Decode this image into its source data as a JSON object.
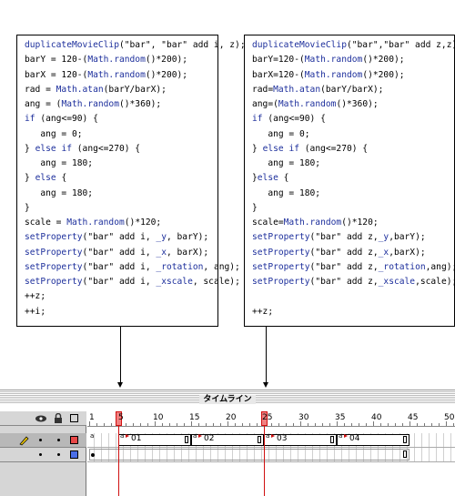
{
  "code_left": {
    "lines": [
      [
        {
          "t": "duplicateMovieClip",
          "k": 1
        },
        {
          "t": "(\"bar\", \"bar\" add i, z);"
        }
      ],
      [
        {
          "t": "barY = 120-("
        },
        {
          "t": "Math.random",
          "k": 1
        },
        {
          "t": "()*200);"
        }
      ],
      [
        {
          "t": "barX = 120-("
        },
        {
          "t": "Math.random",
          "k": 1
        },
        {
          "t": "()*200);"
        }
      ],
      [
        {
          "t": "rad = "
        },
        {
          "t": "Math.atan",
          "k": 1
        },
        {
          "t": "(barY/barX);"
        }
      ],
      [
        {
          "t": "ang = ("
        },
        {
          "t": "Math.random",
          "k": 1
        },
        {
          "t": "()*360);"
        }
      ],
      [
        {
          "t": "if",
          "k": 1
        },
        {
          "t": " (ang<=90) {"
        }
      ],
      [
        {
          "t": "   ang = 0;"
        }
      ],
      [
        {
          "t": "} "
        },
        {
          "t": "else if",
          "k": 1
        },
        {
          "t": " (ang<=270) {"
        }
      ],
      [
        {
          "t": "   ang = 180;"
        }
      ],
      [
        {
          "t": "} "
        },
        {
          "t": "else",
          "k": 1
        },
        {
          "t": " {"
        }
      ],
      [
        {
          "t": "   ang = 180;"
        }
      ],
      [
        {
          "t": "}"
        }
      ],
      [
        {
          "t": "scale = "
        },
        {
          "t": "Math.random",
          "k": 1
        },
        {
          "t": "()*120;"
        }
      ],
      [
        {
          "t": "setProperty",
          "k": 1
        },
        {
          "t": "(\"bar\" add i, "
        },
        {
          "t": "_y",
          "k": 1
        },
        {
          "t": ", barY);"
        }
      ],
      [
        {
          "t": "setProperty",
          "k": 1
        },
        {
          "t": "(\"bar\" add i, "
        },
        {
          "t": "_x",
          "k": 1
        },
        {
          "t": ", barX);"
        }
      ],
      [
        {
          "t": "setProperty",
          "k": 1
        },
        {
          "t": "(\"bar\" add i, "
        },
        {
          "t": "_rotation",
          "k": 1
        },
        {
          "t": ", ang);"
        }
      ],
      [
        {
          "t": "setProperty",
          "k": 1
        },
        {
          "t": "(\"bar\" add i, "
        },
        {
          "t": "_xscale",
          "k": 1
        },
        {
          "t": ", scale);"
        }
      ],
      [
        {
          "t": "++z;"
        }
      ],
      [
        {
          "t": "++i;"
        }
      ]
    ]
  },
  "code_right": {
    "lines": [
      [
        {
          "t": "duplicateMovieClip",
          "k": 1
        },
        {
          "t": "(\"bar\",\"bar\" add z,z);"
        }
      ],
      [
        {
          "t": "barY=120-("
        },
        {
          "t": "Math.random",
          "k": 1
        },
        {
          "t": "()*200);"
        }
      ],
      [
        {
          "t": "barX=120-("
        },
        {
          "t": "Math.random",
          "k": 1
        },
        {
          "t": "()*200);"
        }
      ],
      [
        {
          "t": "rad="
        },
        {
          "t": "Math.atan",
          "k": 1
        },
        {
          "t": "(barY/barX);"
        }
      ],
      [
        {
          "t": "ang=("
        },
        {
          "t": "Math.random",
          "k": 1
        },
        {
          "t": "()*360);"
        }
      ],
      [
        {
          "t": "if",
          "k": 1
        },
        {
          "t": " (ang<=90) {"
        }
      ],
      [
        {
          "t": "   ang = 0;"
        }
      ],
      [
        {
          "t": "} "
        },
        {
          "t": "else if",
          "k": 1
        },
        {
          "t": " (ang<=270) {"
        }
      ],
      [
        {
          "t": "   ang = 180;"
        }
      ],
      [
        {
          "t": "}"
        },
        {
          "t": "else",
          "k": 1
        },
        {
          "t": " {"
        }
      ],
      [
        {
          "t": "   ang = 180;"
        }
      ],
      [
        {
          "t": "}"
        }
      ],
      [
        {
          "t": "scale="
        },
        {
          "t": "Math.random",
          "k": 1
        },
        {
          "t": "()*120;"
        }
      ],
      [
        {
          "t": "setProperty",
          "k": 1
        },
        {
          "t": "(\"bar\" add z,"
        },
        {
          "t": "_y",
          "k": 1
        },
        {
          "t": ",barY);"
        }
      ],
      [
        {
          "t": "setProperty",
          "k": 1
        },
        {
          "t": "(\"bar\" add z,"
        },
        {
          "t": "_x",
          "k": 1
        },
        {
          "t": ",barX);"
        }
      ],
      [
        {
          "t": "setProperty",
          "k": 1
        },
        {
          "t": "(\"bar\" add z,"
        },
        {
          "t": "_rotation",
          "k": 1
        },
        {
          "t": ",ang);"
        }
      ],
      [
        {
          "t": "setProperty",
          "k": 1
        },
        {
          "t": "(\"bar\" add z,"
        },
        {
          "t": "_xscale",
          "k": 1
        },
        {
          "t": ",scale);"
        }
      ],
      [
        {
          "t": ""
        }
      ],
      [
        {
          "t": "++z;"
        }
      ]
    ]
  },
  "timeline": {
    "title": "タイムライン",
    "ruler_numbers": [
      "1",
      "5",
      "10",
      "15",
      "20",
      "25",
      "30",
      "35",
      "40",
      "45",
      "50"
    ],
    "current_frame_markers": [
      "5",
      "25"
    ],
    "keyframe_labels": [
      "01",
      "02",
      "03",
      "04"
    ],
    "keyframe_script_mark": "a",
    "header_icons": [
      "eye-icon",
      "lock-icon",
      "outline-icon"
    ],
    "colors": {
      "playhead": "#d01010",
      "layer1_swatch": "#e84848",
      "layer2_swatch": "#4a6ee8",
      "keyword": "#1d2f9c"
    }
  }
}
